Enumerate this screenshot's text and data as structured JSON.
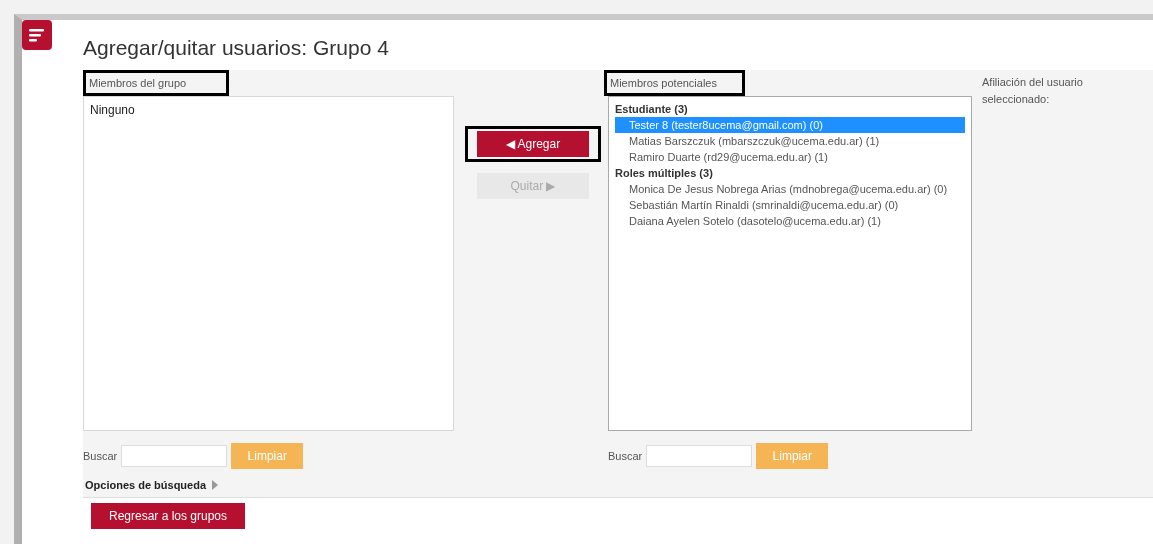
{
  "title": "Agregar/quitar usuarios: Grupo 4",
  "group_members": {
    "label": "Miembros del grupo",
    "highlighted": true,
    "items": [
      {
        "text": "Ninguno",
        "kind": "empty"
      }
    ],
    "search_label": "Buscar",
    "clear_button": "Limpiar"
  },
  "actions": [
    {
      "label": "◀ Agregar",
      "disabled": false,
      "highlighted": true
    },
    {
      "label": "Quitar ▶",
      "disabled": true,
      "highlighted": false
    }
  ],
  "potential_members": {
    "label": "Miembros potenciales",
    "highlighted": true,
    "items": [
      {
        "text": "Estudiante (3)",
        "kind": "group"
      },
      {
        "text": "Tester 8 (tester8ucema@gmail.com) (0)",
        "kind": "user",
        "selected": true
      },
      {
        "text": "Matias Barszczuk (mbarszczuk@ucema.edu.ar) (1)",
        "kind": "user",
        "selected": false
      },
      {
        "text": "Ramiro Duarte (rd29@ucema.edu.ar) (1)",
        "kind": "user",
        "selected": false
      },
      {
        "text": "Roles múltiples (3)",
        "kind": "group"
      },
      {
        "text": "Monica De Jesus Nobrega Arias (mdnobrega@ucema.edu.ar) (0)",
        "kind": "user",
        "selected": false
      },
      {
        "text": "Sebastián Martín Rinaldi (smrinaldi@ucema.edu.ar) (0)",
        "kind": "user",
        "selected": false
      },
      {
        "text": "Daiana Ayelen Sotelo (dasotelo@ucema.edu.ar) (1)",
        "kind": "user",
        "selected": false
      }
    ],
    "search_label": "Buscar",
    "clear_button": "Limpiar"
  },
  "affiliation_label": "Afiliación del usuario seleccionado:",
  "search_options": {
    "label": "Opciones de búsqueda",
    "expanded": false
  },
  "back_button": "Regresar a los grupos"
}
